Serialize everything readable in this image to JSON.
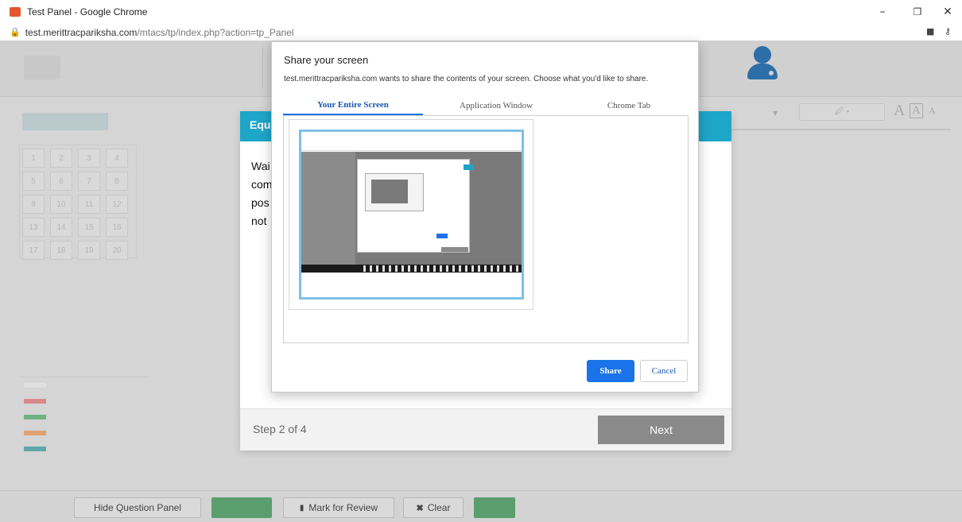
{
  "browser": {
    "window_title": "Test Panel - Google Chrome",
    "url_host": "test.merittracpariksha.com",
    "url_path": "/mtacs/tp/index.php?action=tp_Panel",
    "controls": {
      "minimize": "–",
      "restore": "❐",
      "close": "✕"
    }
  },
  "page": {
    "font_big": "A",
    "font_sel": "A",
    "font_small": "A",
    "questions": [
      "1",
      "2",
      "3",
      "4",
      "5",
      "6",
      "7",
      "8",
      "9",
      "10",
      "11",
      "12",
      "13",
      "14",
      "15",
      "16",
      "17",
      "18",
      "19",
      "20"
    ],
    "legend_colors": [
      "#e0e0e0",
      "#d98a8a",
      "#6fb283",
      "#e0a070",
      "#5fa7a8"
    ]
  },
  "bottom_bar": {
    "hide_panel": "Hide Question Panel",
    "mark_review": "Mark for Review",
    "clear": "Clear"
  },
  "tour": {
    "title_partial": "Equ",
    "body_lines": [
      "Wai",
      "com",
      "pos",
      "not"
    ],
    "step": "Step 2 of 4",
    "next": "Next"
  },
  "share_dialog": {
    "title": "Share your screen",
    "description": "test.merittracpariksha.com wants to share the contents of your screen. Choose what you'd like to share.",
    "tabs": [
      "Your Entire Screen",
      "Application Window",
      "Chrome Tab"
    ],
    "share_button": "Share",
    "cancel_button": "Cancel"
  }
}
